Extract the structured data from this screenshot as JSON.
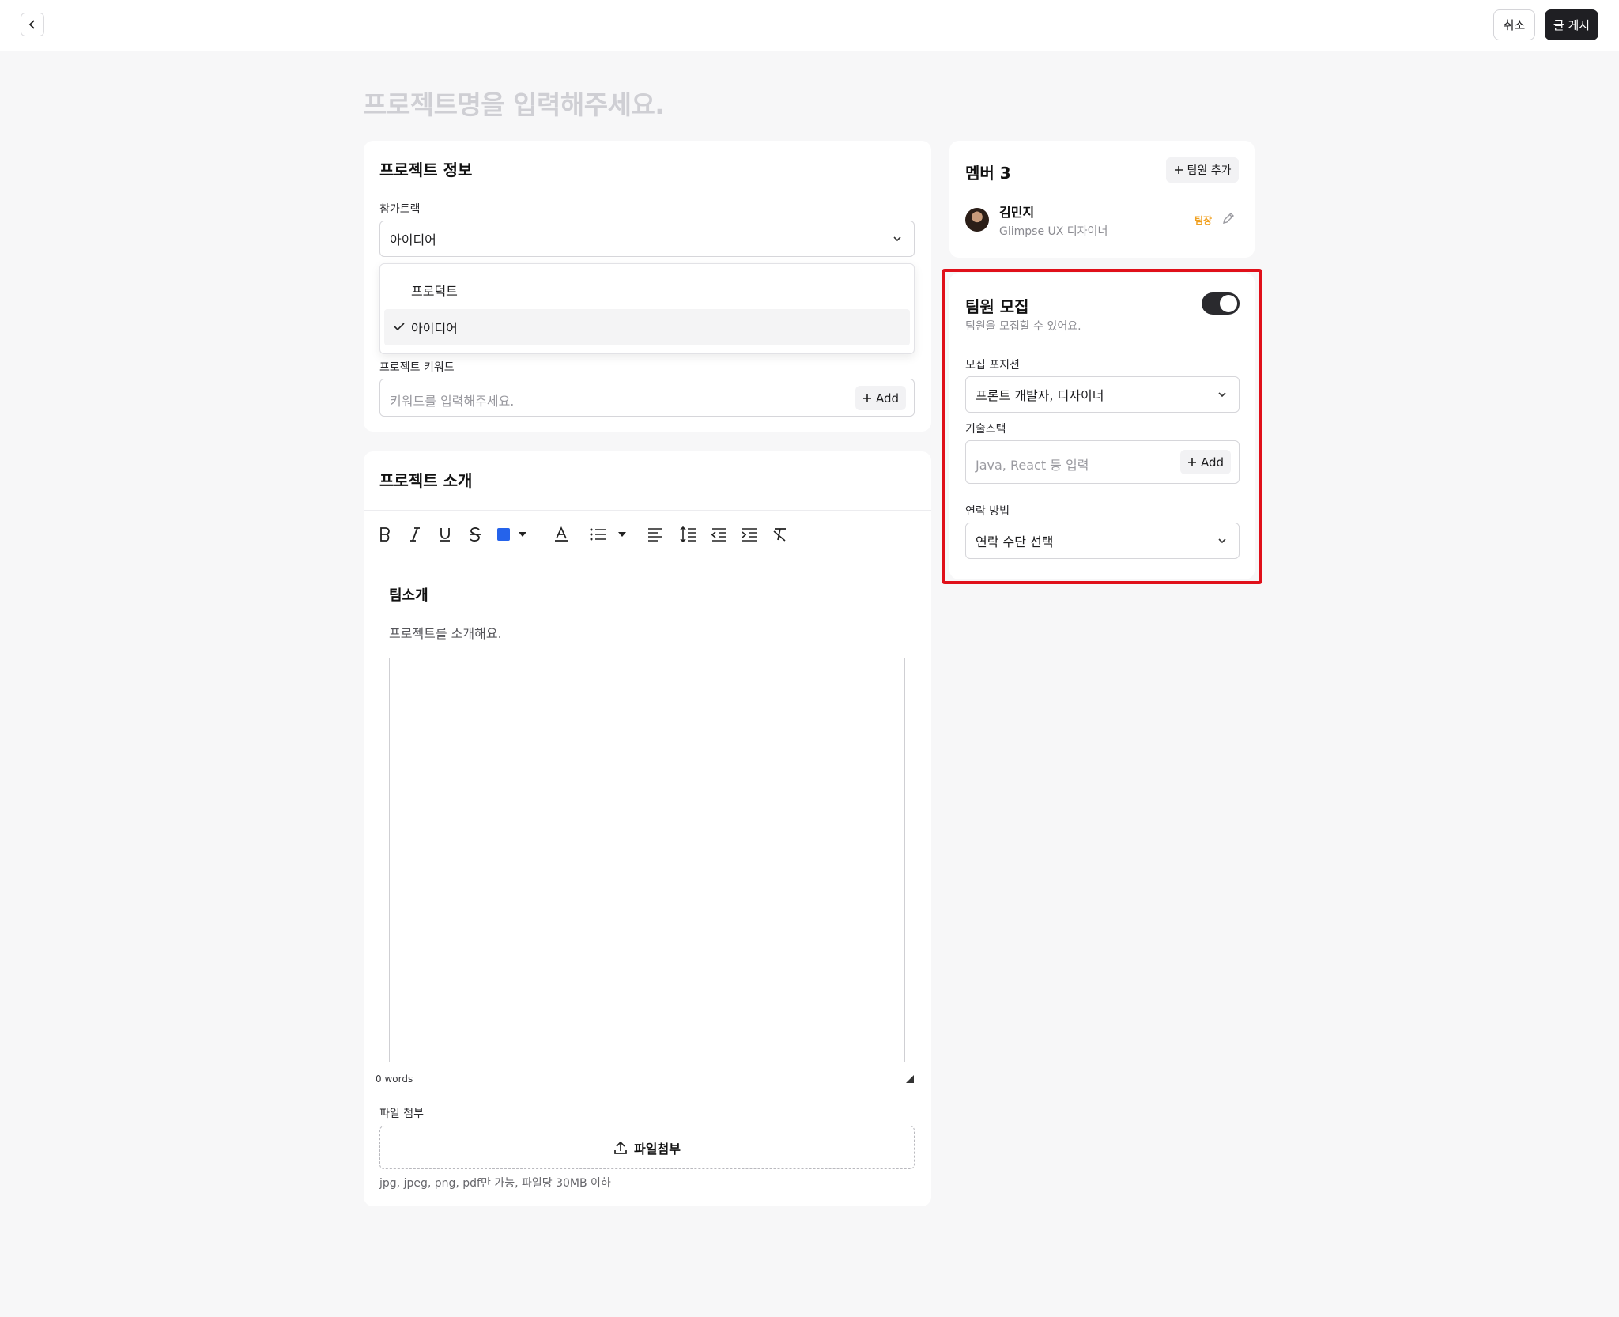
{
  "header": {
    "cancel_label": "취소",
    "post_label": "글 게시"
  },
  "title_placeholder": "프로젝트명을 입력해주세요.",
  "project_info": {
    "title": "프로젝트 정보",
    "track_label": "참가트랙",
    "track_value": "아이디어",
    "track_options": [
      "프로덕트",
      "아이디어"
    ],
    "keyword_label": "프로젝트 키워드",
    "keyword_placeholder": "키워드를 입력해주세요.",
    "keyword_add": "Add"
  },
  "intro": {
    "title": "프로젝트 소개",
    "editor_heading": "팀소개",
    "editor_text": "프로젝트를 소개해요.",
    "word_count": "0 words",
    "file_label": "파일 첨부",
    "file_button": "파일첨부",
    "file_note": "jpg, jpeg, png, pdf만 가능, 파일당 30MB 이하",
    "text_color": "#2563eb"
  },
  "members": {
    "title": "멤버 3",
    "add_label": "팀원 추가",
    "list": [
      {
        "name": "김민지",
        "role": "Glimpse UX 디자이너",
        "badge": "팀장"
      }
    ]
  },
  "recruit": {
    "title": "팀원 모집",
    "description": "팀원을 모집할 수 있어요.",
    "toggle_on": true,
    "position_label": "모집 포지션",
    "position_value": "프론트 개발자, 디자이너",
    "stack_label": "기술스택",
    "stack_placeholder": "Java, React 등 입력",
    "stack_add": "Add",
    "contact_label": "연락 방법",
    "contact_value": "연락 수단 선택"
  },
  "colors": {
    "highlight": "#e0101a",
    "leader_badge": "#f0a020"
  }
}
